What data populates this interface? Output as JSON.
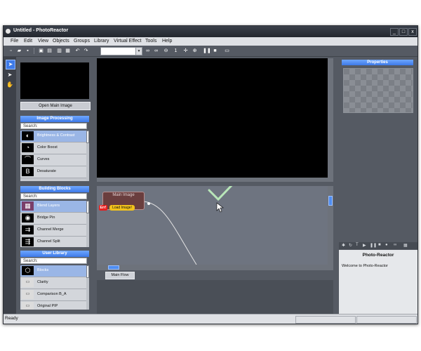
{
  "window": {
    "title": "Untitled - PhotoReactor",
    "minimize": "_",
    "maximize": "□",
    "close": "x"
  },
  "menu": [
    "File",
    "Edit",
    "View",
    "Objects",
    "Groups",
    "Library",
    "Virtual Effect",
    "Tools",
    "Help"
  ],
  "toolbar": {
    "zoom_value": ""
  },
  "left_panel": {
    "open_button": "Open Main Image",
    "image_processing": {
      "header": "Image Processing",
      "search": "Search:",
      "items": [
        {
          "label": "Brightness & Contrast",
          "icon": "brightness-contrast-icon",
          "glyph": "◐"
        },
        {
          "label": "Color Boost",
          "icon": "color-boost-icon",
          "glyph": "◔"
        },
        {
          "label": "Curves",
          "icon": "curves-icon",
          "glyph": "⌒"
        },
        {
          "label": "Desaturate",
          "icon": "desaturate-icon",
          "glyph": "B"
        }
      ]
    },
    "building_blocks": {
      "header": "Building Blocks",
      "search": "Search:",
      "items": [
        {
          "label": "Blend Layers",
          "icon": "blend-layers-icon",
          "glyph": "▦"
        },
        {
          "label": "Bridge Pin",
          "icon": "bridge-pin-icon",
          "glyph": "◉"
        },
        {
          "label": "Channel Merge",
          "icon": "channel-merge-icon",
          "glyph": "⇉"
        },
        {
          "label": "Channel Split",
          "icon": "channel-split-icon",
          "glyph": "⇶"
        }
      ]
    },
    "user_library": {
      "header": "User Library",
      "search": "Search:",
      "items": [
        {
          "label": "Blocks",
          "icon": "blocks-icon",
          "glyph": "⬡"
        },
        {
          "label": "Clarity",
          "icon": "clarity-icon",
          "glyph": "▭"
        },
        {
          "label": "Comparison B_A",
          "icon": "comparison-icon",
          "glyph": "▭"
        },
        {
          "label": "Original PIP",
          "icon": "original-pip-icon",
          "glyph": "▭"
        }
      ]
    }
  },
  "graph": {
    "node": {
      "title": "Main Image",
      "error_badge": "Err!",
      "load_badge": "Load Image!"
    },
    "tab": "Main Flow"
  },
  "right_panel": {
    "properties_header": "Properties",
    "info_title": "Photo-Reactor",
    "info_text": "Welcome to Photo-Reactor"
  },
  "status": {
    "text": "Ready"
  },
  "colors": {
    "accent": "#3e7ae8",
    "check_mark": "#b8e6b8",
    "error": "#e82020",
    "warning": "#f2c21c"
  }
}
